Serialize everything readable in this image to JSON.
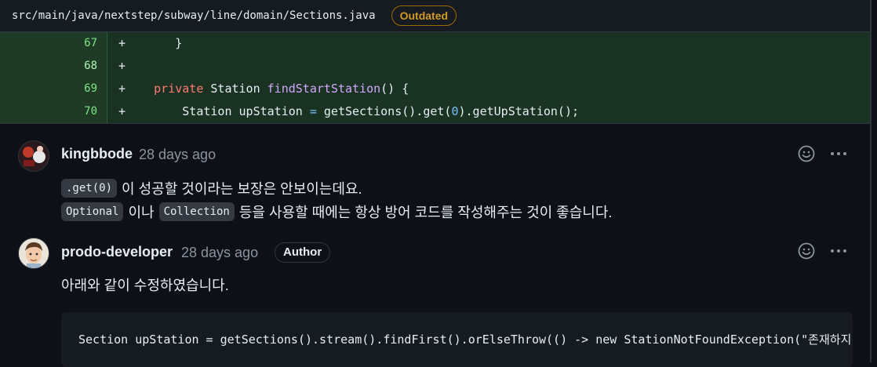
{
  "file": {
    "path": "src/main/java/nextstep/subway/line/domain/Sections.java",
    "status_badge": "Outdated"
  },
  "diff": [
    {
      "line": "67",
      "sign": "+",
      "code": "    }"
    },
    {
      "line": "68",
      "sign": "+",
      "code": ""
    },
    {
      "line": "69",
      "sign": "+",
      "code": "    private Station findStartStation() {"
    },
    {
      "line": "70",
      "sign": "+",
      "code": "        Station upStation = getSections().get(0).getUpStation();"
    }
  ],
  "comments": [
    {
      "author": "kingbbode",
      "time": "28 days ago",
      "line1_chip": ".get(0)",
      "line1_text": "이 성공할 것이라는 보장은 안보이는데요.",
      "line2_chip1": "Optional",
      "line2_mid": "이나",
      "line2_chip2": "Collection",
      "line2_text": "등을 사용할 때에는 항상 방어 코드를 작성해주는 것이 좋습니다."
    },
    {
      "author": "prodo-developer",
      "time": "28 days ago",
      "badge": "Author",
      "text": "아래와 같이 수정하였습니다.",
      "code": "Section upStation = getSections().stream().findFirst().orElseThrow(() -> new StationNotFoundException(\"존재하지"
    }
  ],
  "icons": {
    "emoji": "smiley-icon",
    "more": "kebab-menu-icon"
  }
}
